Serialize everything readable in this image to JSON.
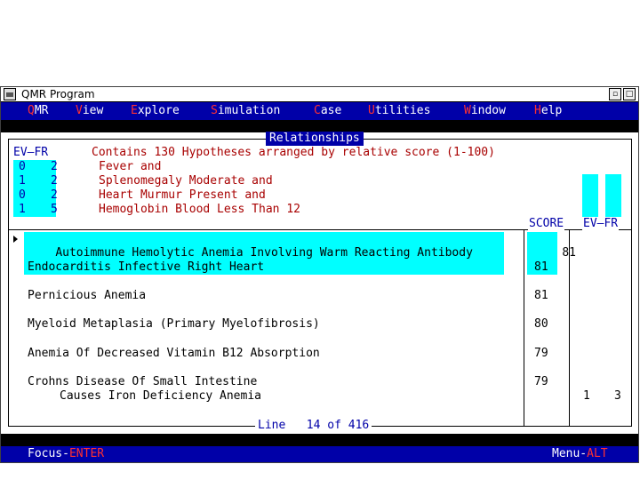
{
  "window": {
    "title": "QMR Program"
  },
  "menu": [
    {
      "hot": "Q",
      "rest": "MR"
    },
    {
      "hot": "V",
      "rest": "iew"
    },
    {
      "hot": "E",
      "rest": "xplore"
    },
    {
      "hot": "S",
      "rest": "imulation"
    },
    {
      "hot": "C",
      "rest": "ase"
    },
    {
      "hot": "U",
      "rest": "tilities"
    },
    {
      "hot": "W",
      "rest": "indow"
    },
    {
      "hot": "H",
      "rest": "elp"
    }
  ],
  "panel": {
    "title": "Relationships",
    "ev_fr_header": "EV—FR",
    "description": "Contains 130 Hypotheses arranged by relative score (1-100)",
    "findings": [
      {
        "ev": "0",
        "fr": "2",
        "text": "Fever and"
      },
      {
        "ev": "1",
        "fr": "2",
        "text": "Splenomegaly Moderate and"
      },
      {
        "ev": "0",
        "fr": "2",
        "text": "Heart Murmur Present and"
      },
      {
        "ev": "1",
        "fr": "5",
        "text": "Hemoglobin Blood Less Than 12"
      }
    ],
    "score_header": "SCORE",
    "ev_fr_header_right": "EV—FR"
  },
  "hypotheses": [
    {
      "line1": "Autoimmune Hemolytic Anemia Involving Warm Reacting Antibody",
      "line2": "",
      "score": "81",
      "ev": "",
      "fr": ""
    },
    {
      "line1": "Endocarditis Infective Right Heart",
      "line2": "",
      "score": "81",
      "ev": "",
      "fr": ""
    },
    {
      "line1": "Pernicious Anemia",
      "line2": "",
      "score": "81",
      "ev": "",
      "fr": ""
    },
    {
      "line1": "Myeloid Metaplasia (Primary Myelofibrosis)",
      "line2": "",
      "score": "80",
      "ev": "",
      "fr": ""
    },
    {
      "line1": "Anemia Of Decreased Vitamin B12 Absorption",
      "line2": "",
      "score": "79",
      "ev": "",
      "fr": ""
    },
    {
      "line1": "Crohns Disease Of Small Intestine",
      "line2": "Causes Iron Deficiency Anemia",
      "score": "79",
      "ev": "1",
      "fr": "3"
    }
  ],
  "footer": {
    "line_text": "Line   14 of 416"
  },
  "status": {
    "focus_label": "Focus-",
    "focus_key": "ENTER",
    "menu_label": "Menu-",
    "menu_key": "ALT"
  },
  "colors": {
    "menu_bg": "#0000a8",
    "highlight": "#00ffff",
    "hotkey": "#ff3030"
  }
}
